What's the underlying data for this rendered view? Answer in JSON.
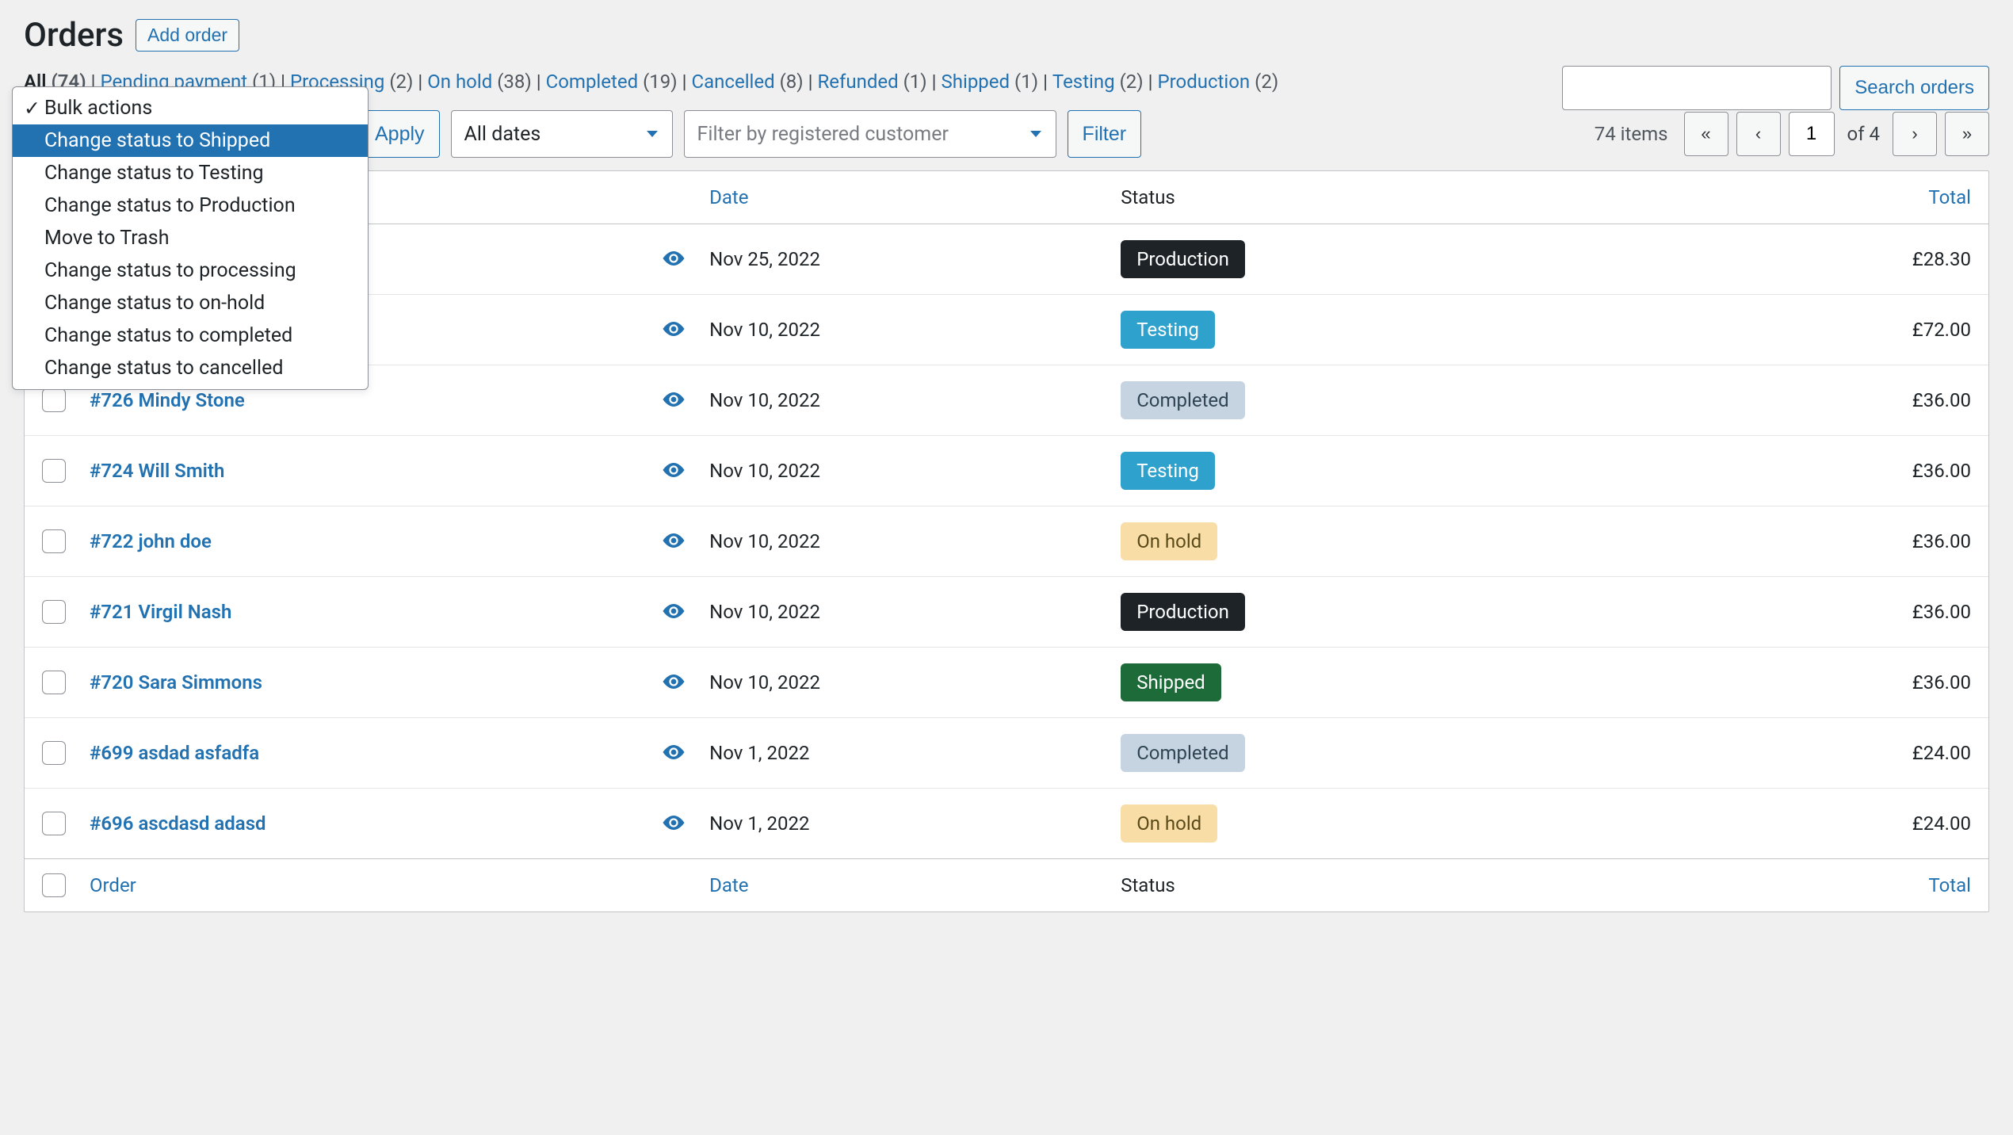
{
  "page_title": "Orders",
  "add_order_label": "Add order",
  "filter_links": [
    {
      "label": "All",
      "count": "(74)",
      "current": true
    },
    {
      "label": "Pending payment",
      "count": "(1)"
    },
    {
      "label": "Processing",
      "count": "(2)"
    },
    {
      "label": "On hold",
      "count": "(38)"
    },
    {
      "label": "Completed",
      "count": "(19)"
    },
    {
      "label": "Cancelled",
      "count": "(8)"
    },
    {
      "label": "Refunded",
      "count": "(1)"
    },
    {
      "label": "Shipped",
      "count": "(1)"
    },
    {
      "label": "Testing",
      "count": "(2)"
    },
    {
      "label": "Production",
      "count": "(2)"
    }
  ],
  "search": {
    "placeholder": "",
    "button": "Search orders"
  },
  "bulk_actions": {
    "current": "Bulk actions",
    "options": [
      {
        "label": "Bulk actions",
        "checked": true
      },
      {
        "label": "Change status to Shipped",
        "highlighted": true
      },
      {
        "label": "Change status to Testing"
      },
      {
        "label": "Change status to Production"
      },
      {
        "label": "Move to Trash"
      },
      {
        "label": "Change status to processing"
      },
      {
        "label": "Change status to on-hold"
      },
      {
        "label": "Change status to completed"
      },
      {
        "label": "Change status to cancelled"
      }
    ]
  },
  "apply_label": "Apply",
  "date_filter": "All dates",
  "customer_filter_placeholder": "Filter by registered customer",
  "filter_label": "Filter",
  "items_count": "74 items",
  "pagination": {
    "current": "1",
    "of": "of 4"
  },
  "columns": {
    "order": "Order",
    "date": "Date",
    "status": "Status",
    "total": "Total"
  },
  "rows": [
    {
      "order": "",
      "date": "Nov 25, 2022",
      "status": "Production",
      "status_class": "sb-production",
      "total": "£28.30",
      "hidden_order": true
    },
    {
      "order": "",
      "date": "Nov 10, 2022",
      "status": "Testing",
      "status_class": "sb-testing",
      "total": "£72.00",
      "hidden_order": true
    },
    {
      "order": "#726 Mindy Stone",
      "date": "Nov 10, 2022",
      "status": "Completed",
      "status_class": "sb-completed",
      "total": "£36.00"
    },
    {
      "order": "#724 Will Smith",
      "date": "Nov 10, 2022",
      "status": "Testing",
      "status_class": "sb-testing",
      "total": "£36.00"
    },
    {
      "order": "#722 john doe",
      "date": "Nov 10, 2022",
      "status": "On hold",
      "status_class": "sb-onhold",
      "total": "£36.00"
    },
    {
      "order": "#721 Virgil Nash",
      "date": "Nov 10, 2022",
      "status": "Production",
      "status_class": "sb-production",
      "total": "£36.00"
    },
    {
      "order": "#720 Sara Simmons",
      "date": "Nov 10, 2022",
      "status": "Shipped",
      "status_class": "sb-shipped",
      "total": "£36.00"
    },
    {
      "order": "#699 asdad asfadfa",
      "date": "Nov 1, 2022",
      "status": "Completed",
      "status_class": "sb-completed",
      "total": "£24.00"
    },
    {
      "order": "#696 ascdasd adasd",
      "date": "Nov 1, 2022",
      "status": "On hold",
      "status_class": "sb-onhold",
      "total": "£24.00"
    }
  ]
}
